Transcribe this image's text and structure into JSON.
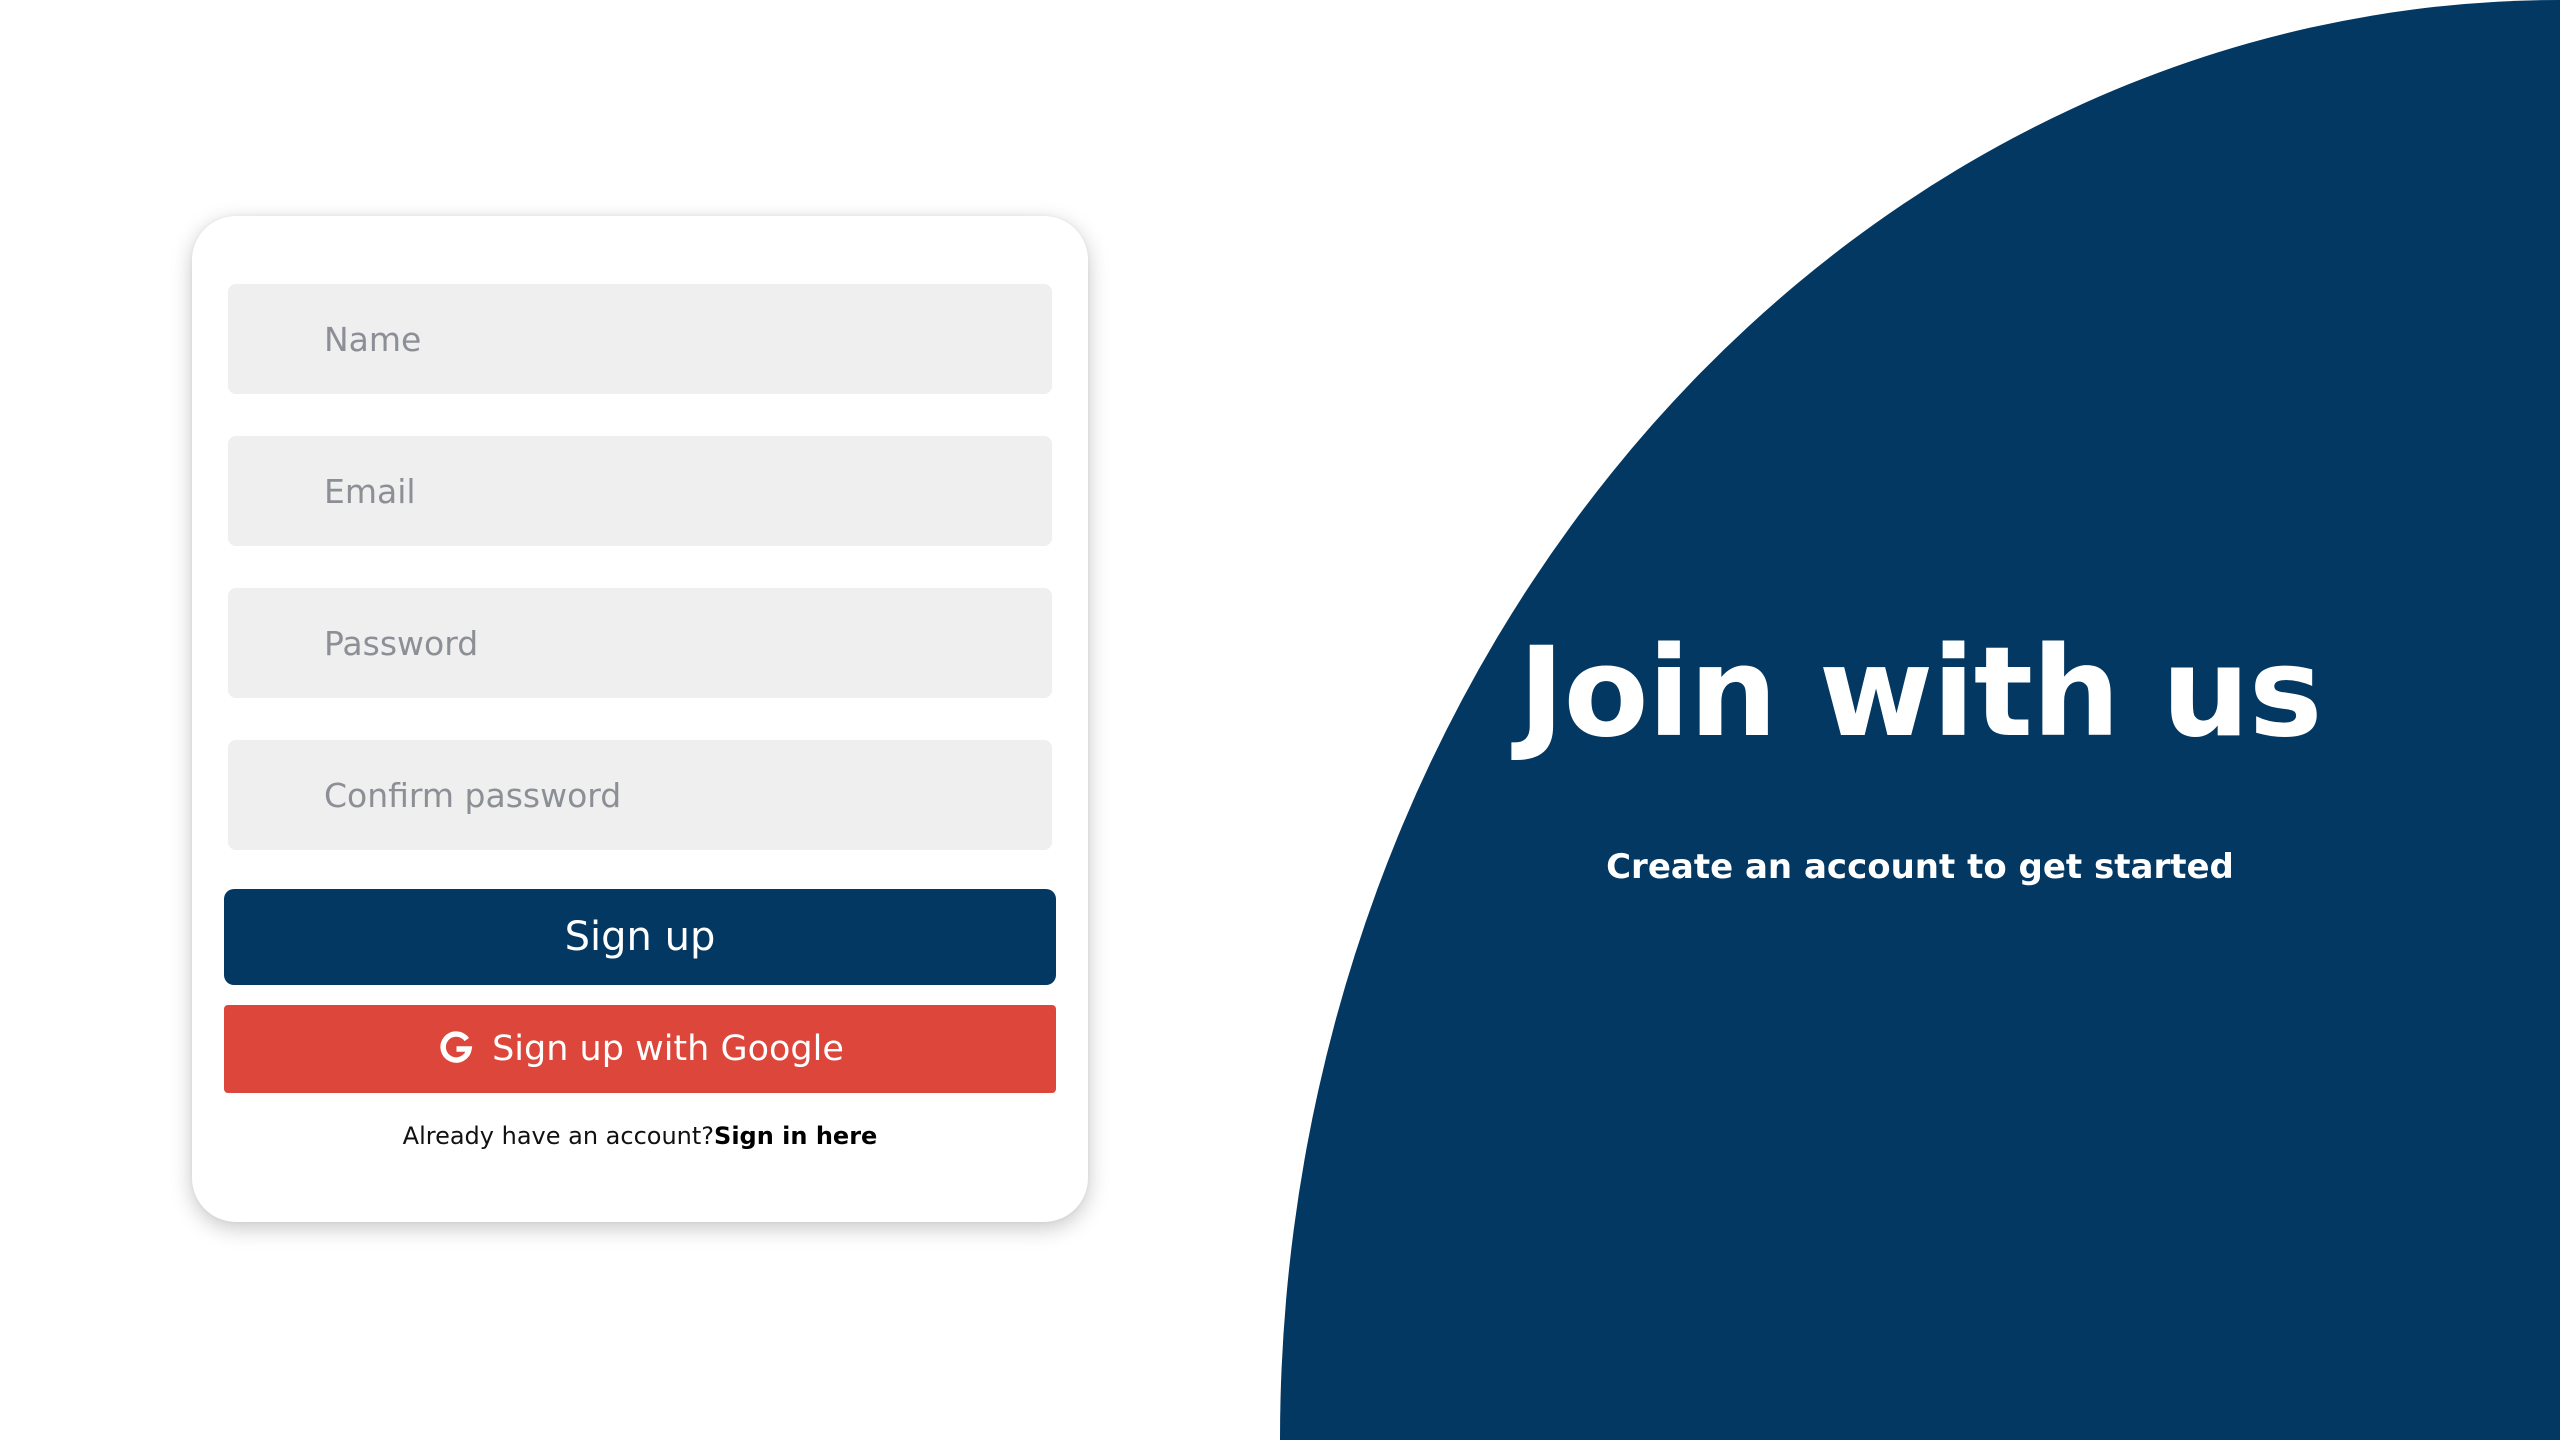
{
  "form": {
    "name_placeholder": "Name",
    "email_placeholder": "Email",
    "password_placeholder": "Password",
    "confirm_placeholder": "Confirm password",
    "signup_label": "Sign up",
    "google_label": "Sign up with Google",
    "google_icon": "google-g-icon",
    "signin_prompt": "Already have an account?",
    "signin_link": "Sign in here"
  },
  "hero": {
    "title": "Join with us",
    "subtitle": "Create an account to get started"
  },
  "colors": {
    "brand_navy": "#033862",
    "google_red": "#dc463b",
    "input_background": "#efefef"
  }
}
